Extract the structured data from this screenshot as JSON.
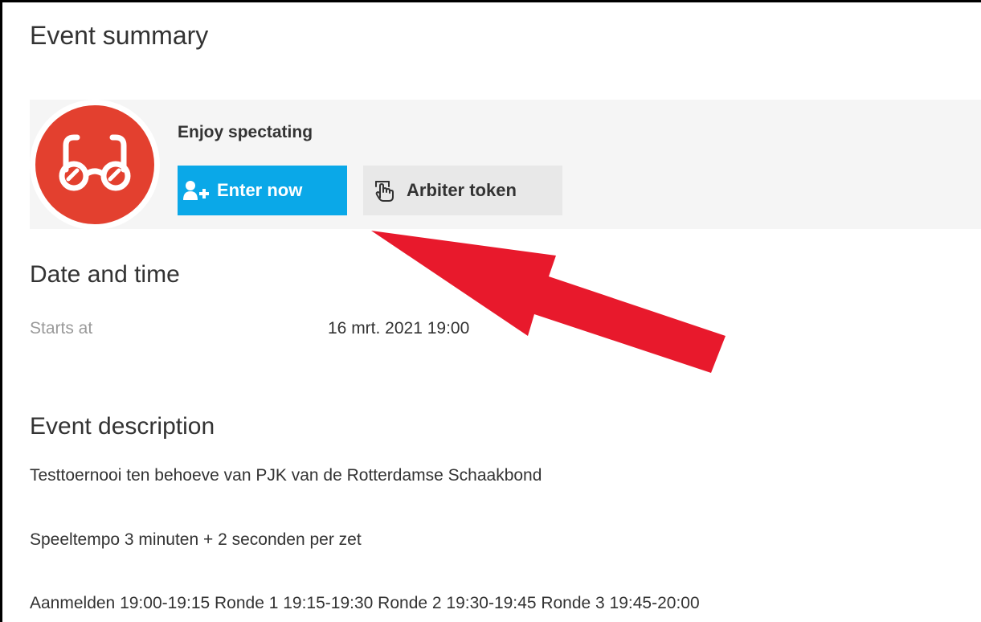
{
  "page": {
    "title": "Event summary"
  },
  "status": {
    "title": "Enjoy spectating",
    "icon": "glasses-icon",
    "icon_color": "#e3402f"
  },
  "actions": {
    "enter_label": "Enter now",
    "enter_icon": "add-user-icon",
    "enter_color": "#0aa8e8",
    "arbiter_label": "Arbiter token",
    "arbiter_icon": "hand-pointer-icon"
  },
  "date_time": {
    "heading": "Date and time",
    "starts_label": "Starts at",
    "starts_value": "16 mrt. 2021 19:00"
  },
  "description": {
    "heading": "Event description",
    "lines": [
      "Testtoernooi ten behoeve van PJK van de Rotterdamse Schaakbond",
      "Speeltempo 3 minuten + 2 seconden per zet",
      "Aanmelden 19:00-19:15 Ronde 1 19:15-19:30 Ronde 2 19:30-19:45 Ronde 3 19:45-20:00"
    ]
  },
  "annotation": {
    "arrow_color": "#e8192c"
  }
}
